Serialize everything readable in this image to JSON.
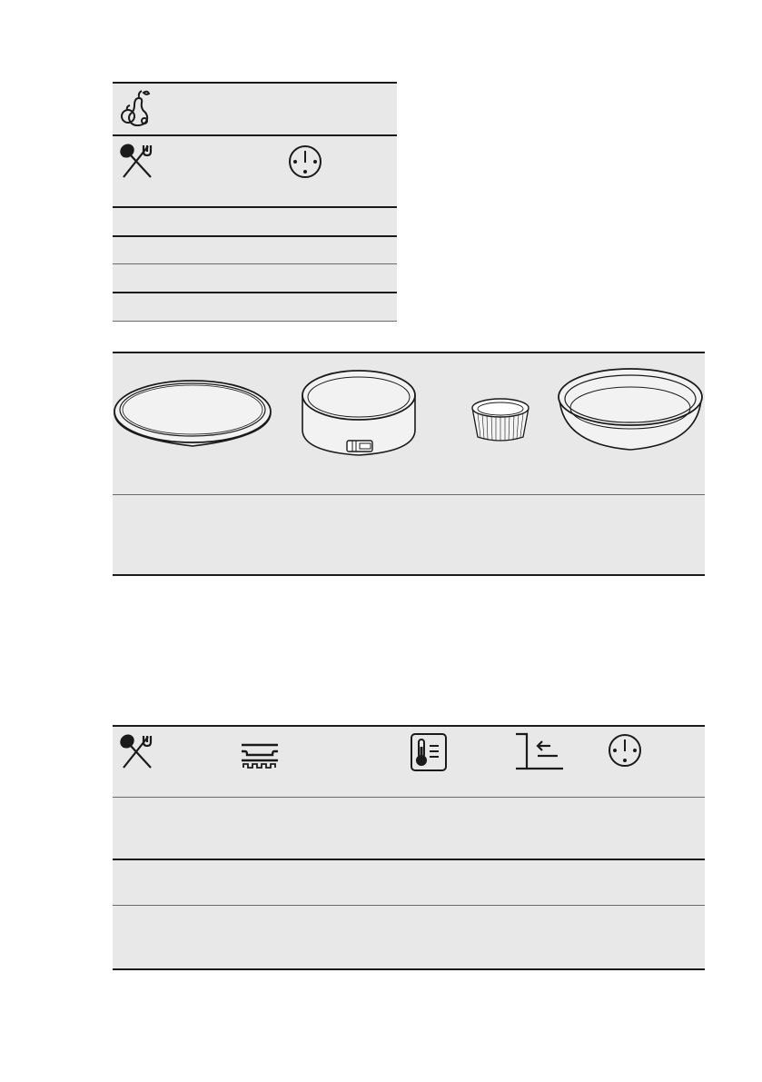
{
  "table1": {
    "header": {
      "fruit_icon": "fruit-pear-apple",
      "cutlery_icon": "spoon-fork",
      "clock_icon": "clock"
    },
    "rows": [
      "",
      "",
      "",
      ""
    ]
  },
  "table2": {
    "pans": [
      "flan-tin",
      "springform-cake-tin",
      "ramekin",
      "deep-pie-dish"
    ],
    "rows": [
      ""
    ]
  },
  "table3": {
    "header_icons": [
      "spoon-fork",
      "shelf-level",
      "thermometer",
      "shelf-position",
      "clock"
    ],
    "rows": [
      "",
      "",
      ""
    ]
  },
  "colors": {
    "table_bg": "#e8e8e8",
    "rule": "#1a1a1a"
  }
}
